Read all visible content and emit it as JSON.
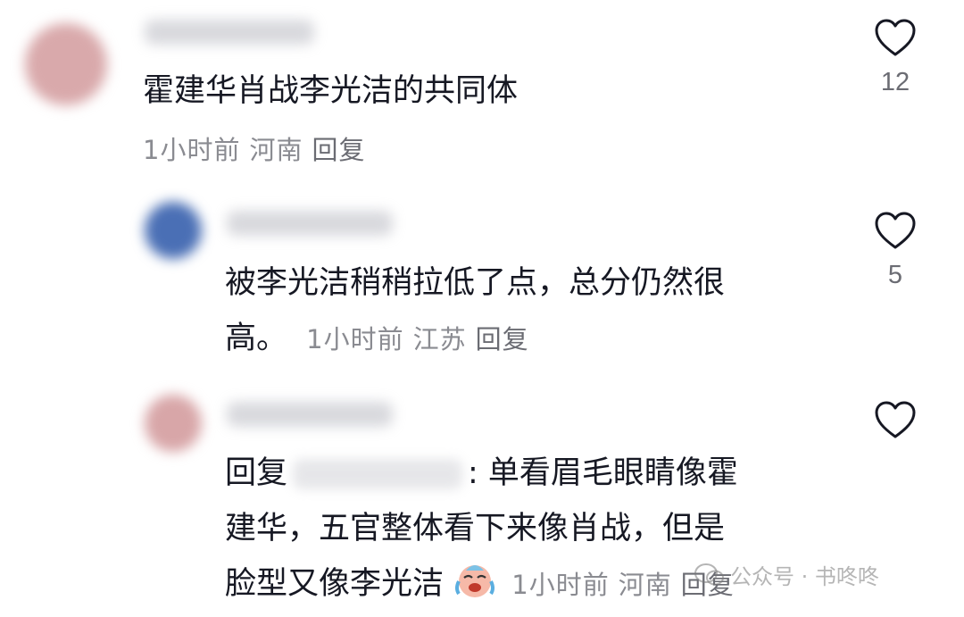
{
  "comments": [
    {
      "text": "霍建华肖战李光洁的共同体",
      "time": "1小时前",
      "location": "河南",
      "reply_label": "回复",
      "likes": "12",
      "avatar_color": "#d9a9ab"
    },
    {
      "text_line1": "被李光洁稍稍拉低了点，总分仍然很",
      "text_line2": "高。",
      "time": "1小时前",
      "location": "江苏",
      "reply_label": "回复",
      "likes": "5",
      "avatar_color": "#4a6fb5"
    },
    {
      "reply_prefix": "回复",
      "text_line1": ": 单看眉毛眼睛像霍",
      "text_line2": "建华，五官整体看下来像肖战，但是",
      "text_line3": "脸型又像李光洁",
      "emoji": "crying-laughing-emoji",
      "time": "1小时前",
      "location": "河南",
      "reply_label": "回复",
      "avatar_color": "#d8a6a8"
    }
  ],
  "watermark": {
    "text": "公众号 · 书咚咚"
  }
}
